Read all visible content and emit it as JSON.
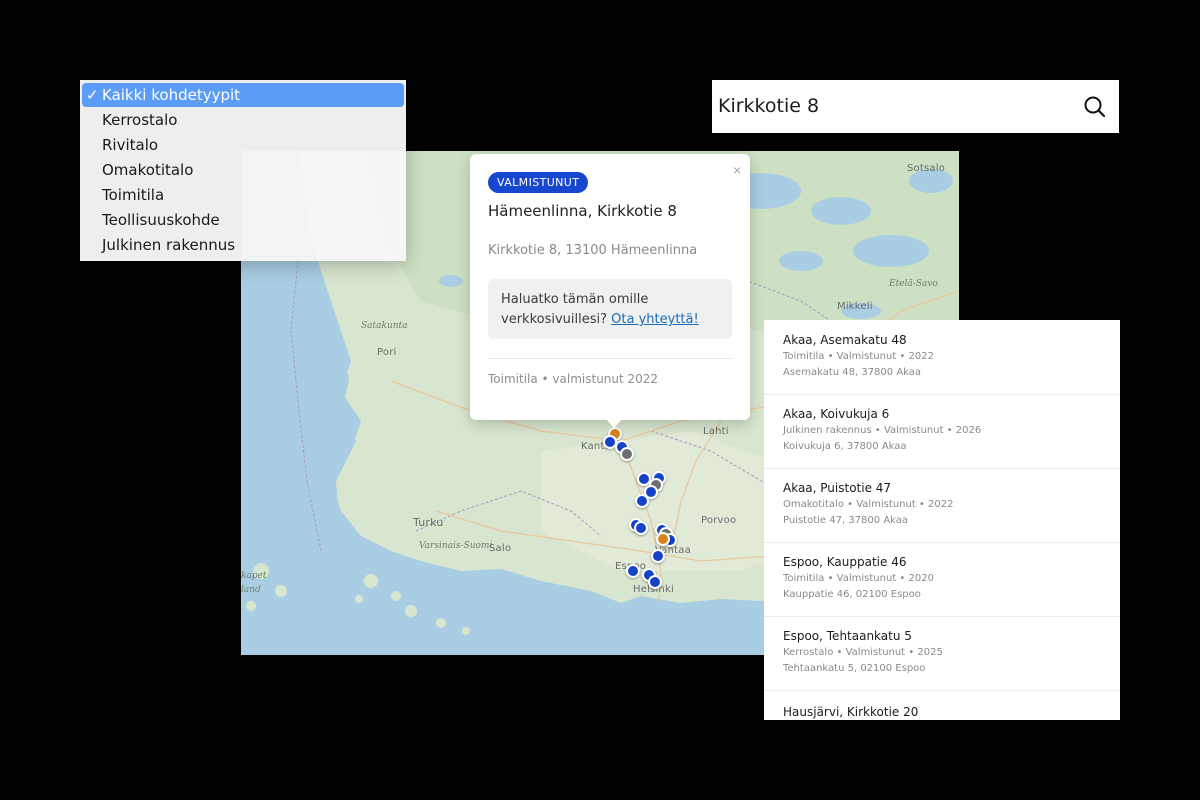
{
  "dropdown": {
    "check": "✓",
    "options": [
      "Kaikki kohdetyypit",
      "Kerrostalo",
      "Rivitalo",
      "Omakotitalo",
      "Toimitila",
      "Teollisuuskohde",
      "Julkinen rakennus"
    ],
    "selected": "Kaikki kohdetyypit",
    "selected_color": "#5a9cf6"
  },
  "search": {
    "value": "Kirkkotie 8",
    "icon": "search-icon"
  },
  "map": {
    "cities": [
      "Sotsalo",
      "Etelä-Savo",
      "Mikkeli",
      "Satakunta",
      "Pori",
      "Lahti",
      "Turku",
      "Varsinais-Suomi",
      "Salo",
      "Porvoo",
      "Helsinki",
      "Kanta",
      "Vantaa",
      "Espoo",
      "kapet",
      "land"
    ],
    "marker_colors": {
      "blue": "#1543c7",
      "gray": "#6e6e6e",
      "orange": "#d9821f"
    }
  },
  "popup": {
    "close": "×",
    "badge": "VALMISTUNUT",
    "badge_color": "#1746cf",
    "title": "Hämeenlinna, Kirkkotie 8",
    "address": "Kirkkotie 8, 13100 Hämeenlinna",
    "cta_text": "Haluatko tämän omille verkkosivuillesi?",
    "cta_link": "Ota yhteyttä!",
    "footer": "Toimitila • valmistunut 2022"
  },
  "results": [
    {
      "title": "Akaa, Asemakatu 48",
      "meta": "Toimitila • Valmistunut • 2022",
      "address": "Asemakatu 48, 37800 Akaa"
    },
    {
      "title": "Akaa, Koivukuja 6",
      "meta": "Julkinen rakennus • Valmistunut • 2026",
      "address": "Koivukuja 6, 37800 Akaa"
    },
    {
      "title": "Akaa, Puistotie 47",
      "meta": "Omakotitalo • Valmistunut • 2022",
      "address": "Puistotie 47, 37800 Akaa"
    },
    {
      "title": "Espoo, Kauppatie 46",
      "meta": "Toimitila • Valmistunut • 2020",
      "address": "Kauppatie 46, 02100 Espoo"
    },
    {
      "title": "Espoo, Tehtaankatu 5",
      "meta": "Kerrostalo • Valmistunut • 2025",
      "address": "Tehtaankatu 5, 02100 Espoo"
    },
    {
      "title": "Hausjärvi, Kirkkotie 20",
      "meta": "",
      "address": ""
    }
  ]
}
